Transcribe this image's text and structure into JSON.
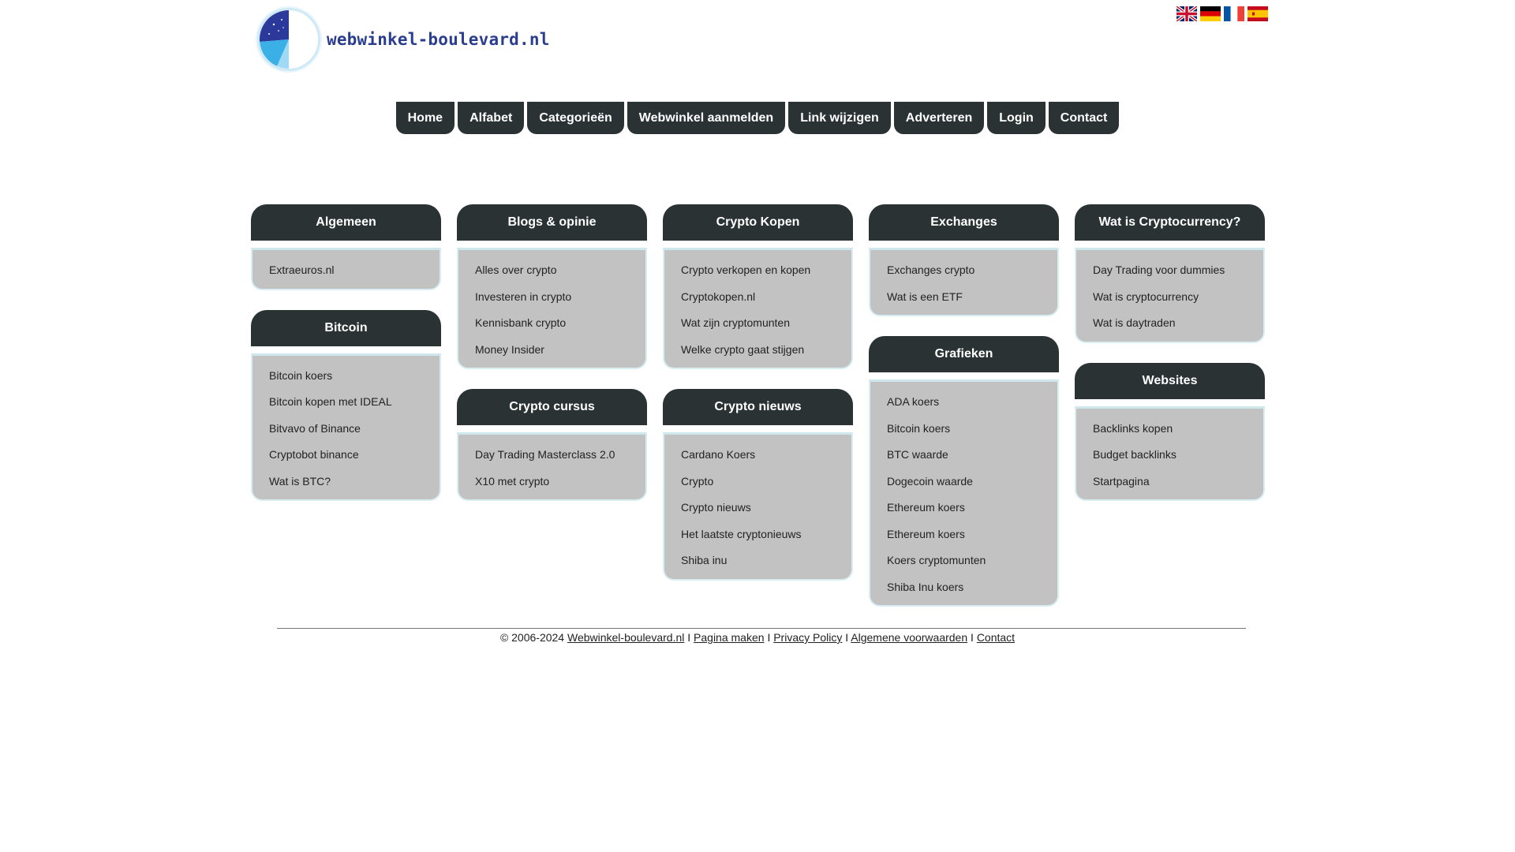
{
  "brand": {
    "logo_text": "webwinkel-boulevard.nl"
  },
  "flags": [
    "uk-flag-icon",
    "germany-flag-icon",
    "france-flag-icon",
    "spain-flag-icon"
  ],
  "nav": [
    "Home",
    "Alfabet",
    "Categorieën",
    "Webwinkel aanmelden",
    "Link wijzigen",
    "Adverteren",
    "Login",
    "Contact"
  ],
  "columns": [
    [
      {
        "title": "Algemeen",
        "links": [
          "Extraeuros.nl"
        ]
      },
      {
        "title": "Bitcoin",
        "links": [
          "Bitcoin koers",
          "Bitcoin kopen met IDEAL",
          "Bitvavo of Binance",
          "Cryptobot binance",
          "Wat is BTC?"
        ]
      }
    ],
    [
      {
        "title": "Blogs & opinie",
        "links": [
          "Alles over crypto",
          "Investeren in crypto",
          "Kennisbank crypto",
          "Money Insider"
        ]
      },
      {
        "title": "Crypto cursus",
        "links": [
          "Day Trading Masterclass 2.0",
          "X10 met crypto"
        ]
      }
    ],
    [
      {
        "title": "Crypto Kopen",
        "links": [
          "Crypto verkopen en kopen",
          "Cryptokopen.nl",
          "Wat zijn cryptomunten",
          "Welke crypto gaat stijgen"
        ]
      },
      {
        "title": "Crypto nieuws",
        "links": [
          "Cardano Koers",
          "Crypto",
          "Crypto nieuws",
          "Het laatste cryptonieuws",
          "Shiba inu"
        ]
      }
    ],
    [
      {
        "title": "Exchanges",
        "links": [
          "Exchanges crypto",
          "Wat is een ETF"
        ]
      },
      {
        "title": "Grafieken",
        "links": [
          "ADA koers",
          "Bitcoin koers",
          "BTC waarde",
          "Dogecoin waarde",
          "Ethereum koers",
          "Ethereum koers",
          "Koers cryptomunten",
          "Shiba Inu koers"
        ]
      }
    ],
    [
      {
        "title": "Wat is Cryptocurrency?",
        "links": [
          "Day Trading voor dummies",
          "Wat is cryptocurrency",
          "Wat is daytraden"
        ]
      },
      {
        "title": "Websites",
        "links": [
          "Backlinks kopen",
          "Budget backlinks",
          "Startpagina"
        ]
      }
    ]
  ],
  "footer": {
    "copyright": "© 2006-2024",
    "separator": "I",
    "links": [
      "Webwinkel-boulevard.nl",
      "Pagina maken",
      "Privacy Policy",
      "Algemene voorwaarden",
      "Contact"
    ]
  }
}
